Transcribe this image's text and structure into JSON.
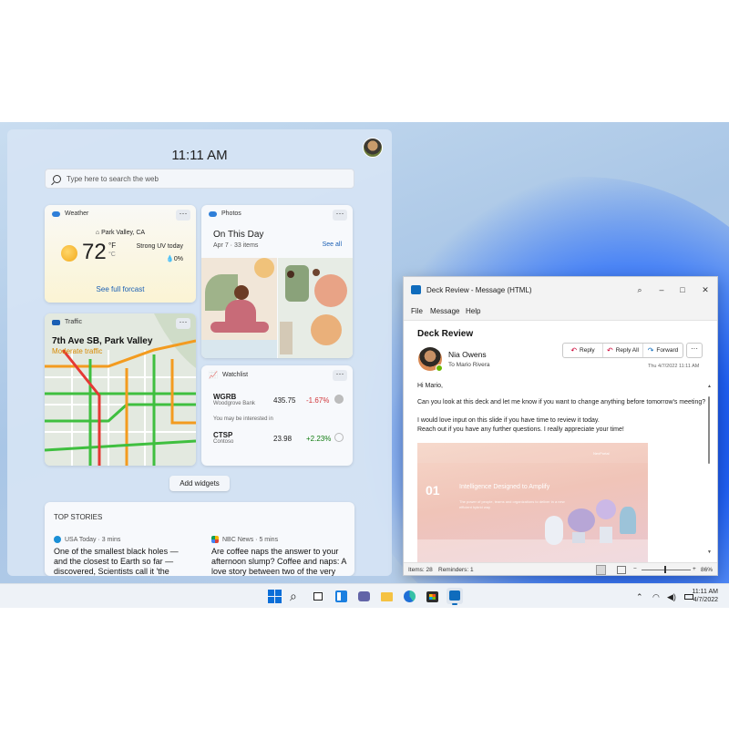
{
  "widgets": {
    "time": "11:11 AM",
    "search_placeholder": "Type here to search the web",
    "weather": {
      "label": "Weather",
      "location": "Park Valley, CA",
      "temperature": "72",
      "unit_f": "°F",
      "unit_c": "°C",
      "condition": "Strong UV today",
      "precip": "0%",
      "link": "See full forcast"
    },
    "photos": {
      "label": "Photos",
      "title": "On This Day",
      "subtitle": "Apr 7 · 33 items",
      "see_all": "See all"
    },
    "traffic": {
      "label": "Traffic",
      "road": "7th Ave SB, Park Valley",
      "status": "Moderate traffic"
    },
    "watchlist": {
      "label": "Watchlist",
      "interest_label": "You may be interested in",
      "stocks": [
        {
          "symbol": "WGRB",
          "company": "Woodgrove Bank",
          "price": "435.75",
          "change": "-1.67%"
        },
        {
          "symbol": "CTSP",
          "company": "Contoso",
          "price": "23.98",
          "change": "+2.23%"
        }
      ]
    },
    "add_widgets": "Add widgets",
    "top_stories": {
      "title": "TOP STORIES",
      "items": [
        {
          "source": "USA Today · 3 mins",
          "headline": "One of the smallest black holes — and the closest to Earth so far — discovered, Scientists call it 'the"
        },
        {
          "source": "NBC News · 5 mins",
          "headline": "Are coffee naps the answer to your afternoon slump? Coffee and naps: A love story between two of the very"
        }
      ]
    }
  },
  "mail": {
    "window_title": "Deck Review - Message (HTML)",
    "menu": [
      "File",
      "Message",
      "Help"
    ],
    "subject": "Deck Review",
    "sender": "Nia Owens",
    "to": "To  Mario Rivera",
    "actions": {
      "reply": "Reply",
      "reply_all": "Reply All",
      "forward": "Forward"
    },
    "date": "Thu 4/7/2022 11:11 AM",
    "body": [
      "Hi Mario,",
      "Can you look at this deck and let me know if you want to change anything before tomorrow's meeting?",
      "I would love input on this slide if you have time to review it today.",
      "Reach out if you have any further questions. I really appreciate your time!"
    ],
    "slide": {
      "number": "01",
      "title": "Intelligence Designed to Amplify",
      "brand": "NexPortal",
      "subtitle": "The power of people, teams and organizations to deliver in a new efficient hybrid way"
    },
    "status": {
      "items": "Items: 28",
      "reminders": "Reminders: 1",
      "zoom": "86%"
    }
  },
  "taskbar": {
    "time": "11:11 AM",
    "date": "4/7/2022",
    "icons": [
      "start-icon",
      "search-icon",
      "task-view-icon",
      "widgets-icon",
      "teams-icon",
      "file-explorer-icon",
      "edge-icon",
      "store-icon",
      "outlook-icon"
    ]
  }
}
